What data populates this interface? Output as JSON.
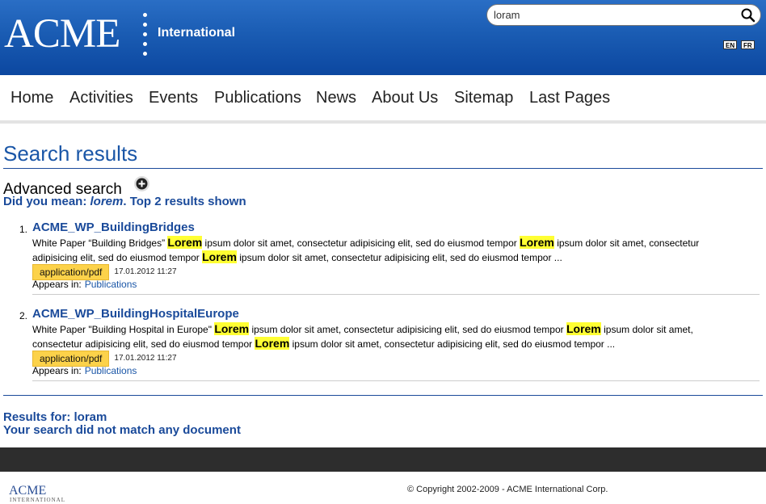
{
  "header": {
    "logo": "ACME",
    "logo_sub": "International",
    "search_value": "loram",
    "languages": [
      "EN",
      "FR"
    ]
  },
  "nav": {
    "items": [
      "Home",
      "Activities",
      "Events",
      "Publications",
      "News",
      "About Us",
      "Sitemap",
      "Last Pages"
    ]
  },
  "main": {
    "title": "Search results",
    "advanced_search": "Advanced search",
    "did_you_mean_prefix": "Did you mean: ",
    "did_you_mean_term": "lorem",
    "did_you_mean_suffix": ".  Top 2 results shown",
    "results": [
      {
        "number": "1.",
        "title": "ACME_WP_BuildingBridges",
        "snippet_parts": [
          {
            "text": "White Paper “Building Bridges” ",
            "hl": false
          },
          {
            "text": "Lorem",
            "hl": true
          },
          {
            "text": " ipsum dolor sit amet, consectetur adipisicing elit, sed do eiusmod tempor ",
            "hl": false
          },
          {
            "text": "Lorem",
            "hl": true
          },
          {
            "text": " ipsum dolor sit amet, consectetur adipisicing elit, sed do eiusmod tempor ",
            "hl": false
          },
          {
            "text": "Lorem",
            "hl": true
          },
          {
            "text": " ipsum dolor sit amet, consectetur adipisicing elit, sed do eiusmod tempor ...",
            "hl": false
          }
        ],
        "mime": "application/pdf",
        "date": "17.01.2012 11:27",
        "appears_label": "Appears in:",
        "appears_link": "Publications"
      },
      {
        "number": "2.",
        "title": "ACME_WP_BuildingHospitalEurope",
        "snippet_parts": [
          {
            "text": "White Paper \"Building Hospital in Europe\" ",
            "hl": false
          },
          {
            "text": "Lorem",
            "hl": true
          },
          {
            "text": " ipsum dolor sit amet, consectetur adipisicing elit, sed do eiusmod tempor ",
            "hl": false
          },
          {
            "text": "Lorem",
            "hl": true
          },
          {
            "text": " ipsum dolor sit amet, consectetur adipisicing elit, sed do eiusmod tempor ",
            "hl": false
          },
          {
            "text": "Lorem",
            "hl": true
          },
          {
            "text": " ipsum dolor sit amet, consectetur adipisicing elit, sed do eiusmod tempor ...",
            "hl": false
          }
        ],
        "mime": "application/pdf",
        "date": "17.01.2012 11:27",
        "appears_label": "Appears in:",
        "appears_link": "Publications"
      }
    ],
    "results_for": "Results for: loram",
    "no_match": "Your search did not match any document"
  },
  "footer": {
    "logo": "ACME",
    "logo_sub": "INTERNATIONAL",
    "copyright": "© Copyright 2002-2009 - ACME International Corp."
  }
}
